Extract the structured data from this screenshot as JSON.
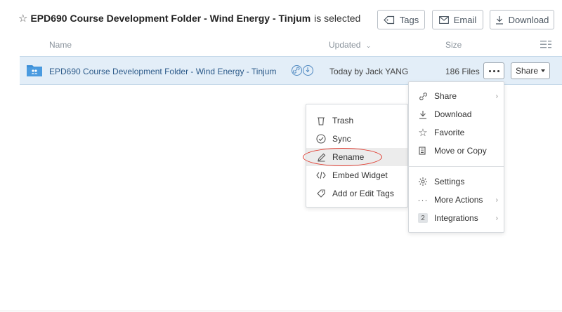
{
  "header": {
    "title_bold": "EPD690 Course Development Folder - Wind Energy - Tinjum",
    "title_rest": "is selected",
    "buttons": {
      "tags": "Tags",
      "email": "Email",
      "download": "Download"
    }
  },
  "columns": {
    "name": "Name",
    "updated": "Updated",
    "size": "Size"
  },
  "row": {
    "name": "EPD690 Course Development Folder - Wind Energy - Tinjum",
    "updated": "Today by Jack YANG",
    "size": "186 Files",
    "share_label": "Share"
  },
  "menu_left": {
    "items": [
      "Trash",
      "Sync",
      "Rename",
      "Embed Widget",
      "Add or Edit Tags"
    ]
  },
  "menu_right": {
    "items": [
      "Share",
      "Download",
      "Favorite",
      "Move or Copy",
      "Settings",
      "More Actions",
      "Integrations"
    ],
    "integrations_count": "2"
  },
  "icons": {
    "star": "star-icon",
    "tag": "tag-icon",
    "email": "email-icon",
    "download": "download-icon",
    "folder": "collab-folder-icon",
    "link": "link-icon",
    "sync": "sync-icon",
    "trash": "trash-icon",
    "rename": "pencil-icon",
    "embed": "code-icon",
    "settings": "gear-icon"
  },
  "colors": {
    "accent": "#2d5b8a",
    "row_selected": "#e3eef8",
    "highlight_circle": "#e03a2e",
    "folder_blue": "#3d8fd6"
  }
}
